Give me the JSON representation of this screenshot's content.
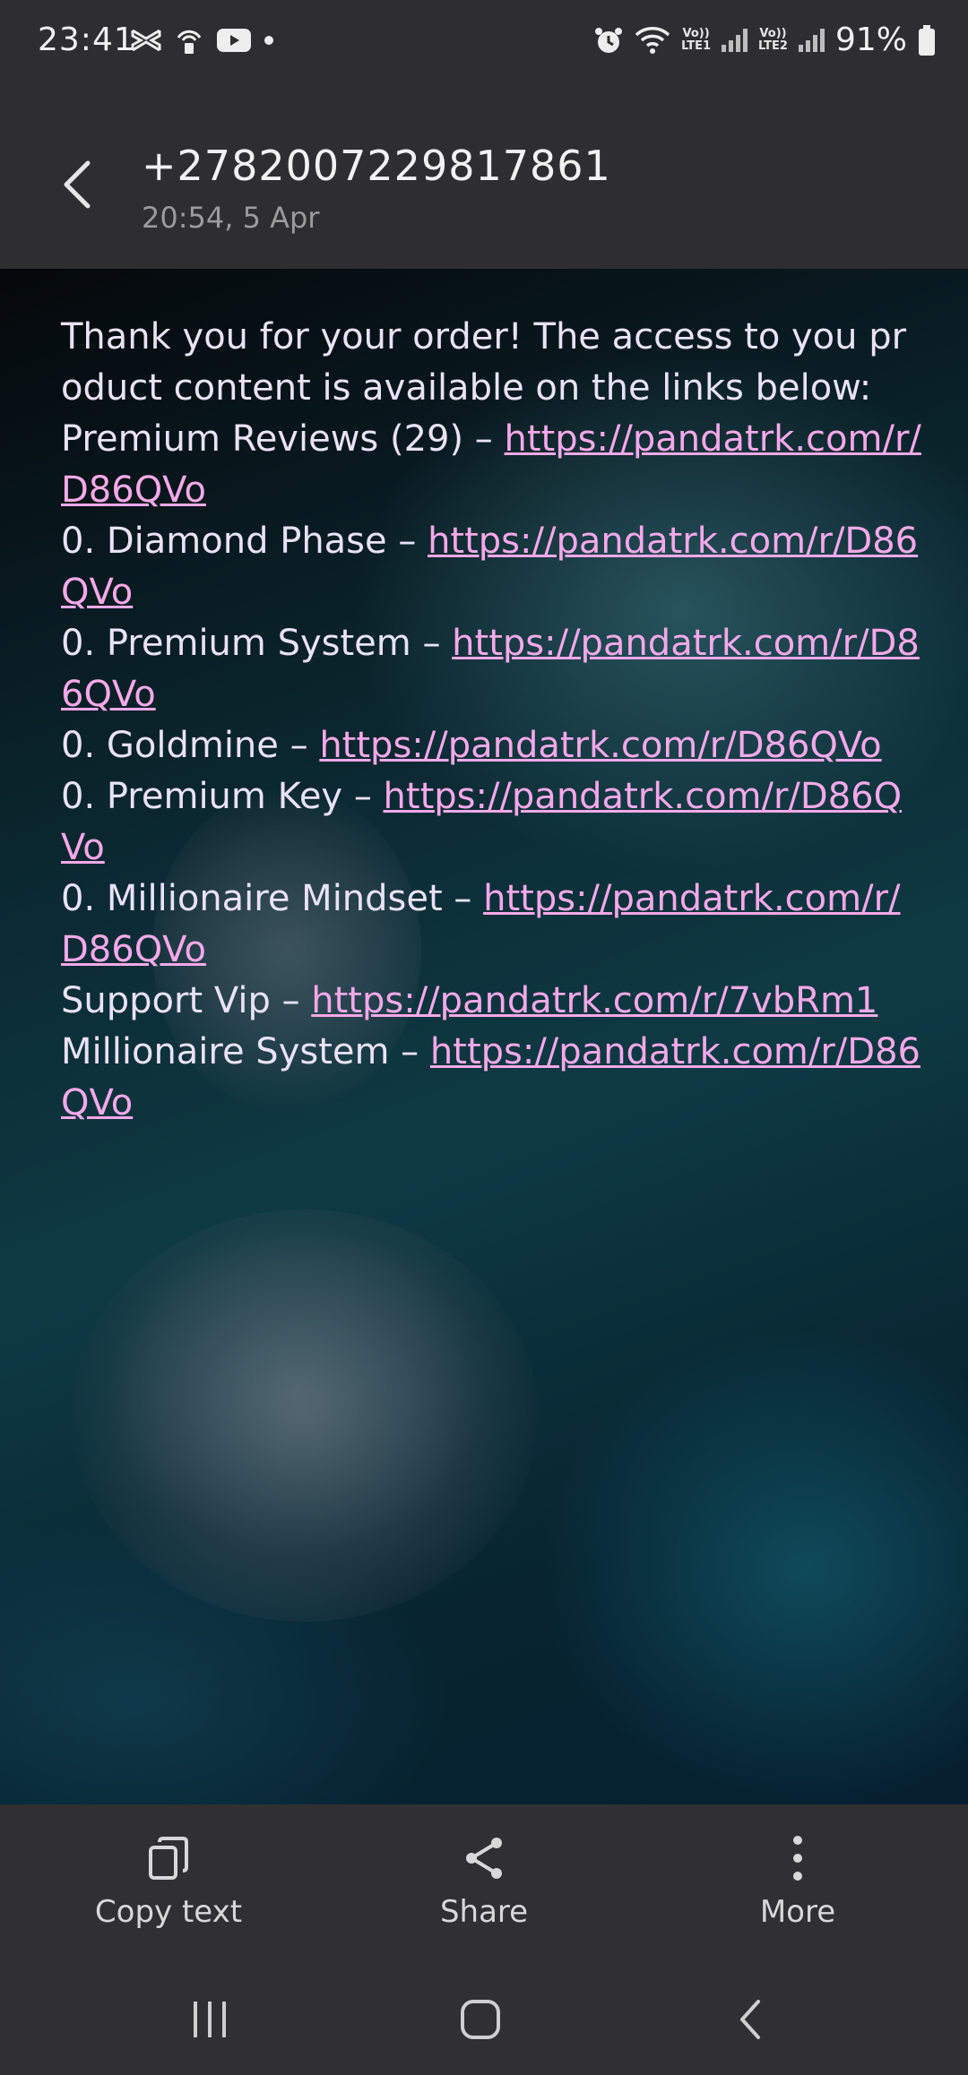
{
  "status_bar": {
    "time": "23:41",
    "battery": "91%",
    "sim1": "LTE1",
    "sim2": "LTE2",
    "volte": "Vo))"
  },
  "header": {
    "contact": "+2782007229817861",
    "date": "20:54, 5 Apr"
  },
  "message": {
    "intro": "Thank you for your order! The access to you product content is available on the links below:",
    "items": [
      {
        "label": "Premium Reviews (29) – ",
        "url": "https://pandatrk.com/r/D86QVo"
      },
      {
        "label": "0. Diamond Phase – ",
        "url": "https://pandatrk.com/r/D86QVo"
      },
      {
        "label": "0. Premium System – ",
        "url": "https://pandatrk.com/r/D86QVo"
      },
      {
        "label": "0. Goldmine – ",
        "url": "https://pandatrk.com/r/D86QVo"
      },
      {
        "label": "0. Premium Key – ",
        "url": "https://pandatrk.com/r/D86QVo"
      },
      {
        "label": "0. Millionaire Mindset – ",
        "url": "https://pandatrk.com/r/D86QVo"
      },
      {
        "label": "Support Vip – ",
        "url": "https://pandatrk.com/r/7vbRm1"
      },
      {
        "label": "Millionaire System – ",
        "url": "https://pandatrk.com/r/D86QVo"
      }
    ]
  },
  "actions": {
    "copy_text": "Copy text",
    "share": "Share",
    "more": "More"
  },
  "colors": {
    "link": "#f6a8e8",
    "text": "#e9e2f6",
    "bar": "#303032"
  }
}
